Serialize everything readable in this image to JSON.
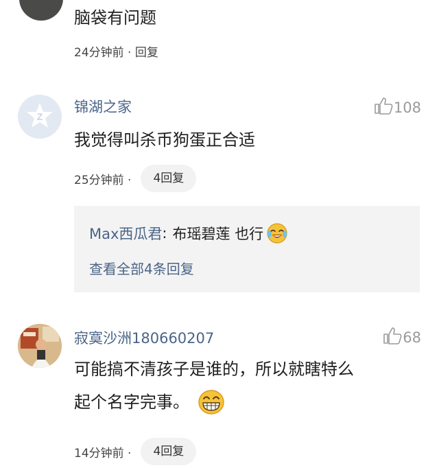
{
  "comments": [
    {
      "text": "脑袋有问题",
      "time": "24分钟前 · 回复"
    },
    {
      "username": "锦湖之家",
      "likes": "108",
      "text": "我觉得叫杀币狗蛋正合适",
      "time": "25分钟前 ·",
      "reply_count": "4回复",
      "replies": [
        {
          "author": "Max西瓜君",
          "separator": ":",
          "text": "布瑶碧莲 也行"
        }
      ],
      "view_all": "查看全部4条回复"
    },
    {
      "username": "寂寞沙洲180660207",
      "likes": "68",
      "text_line1": "可能搞不清孩子是谁的，所以就瞎特么",
      "text_line2": "起个名字完事。",
      "time": "14分钟前 ·",
      "reply_count": "4回复"
    }
  ],
  "colors": {
    "link": "#4a6487",
    "meta": "#444444",
    "pill_bg": "#f2f2f2",
    "reply_box_bg": "#f3f3f3"
  },
  "icons": [
    "thumb-up-icon",
    "laugh-cry-emoji-icon",
    "grin-emoji-icon",
    "default-avatar-icon"
  ]
}
